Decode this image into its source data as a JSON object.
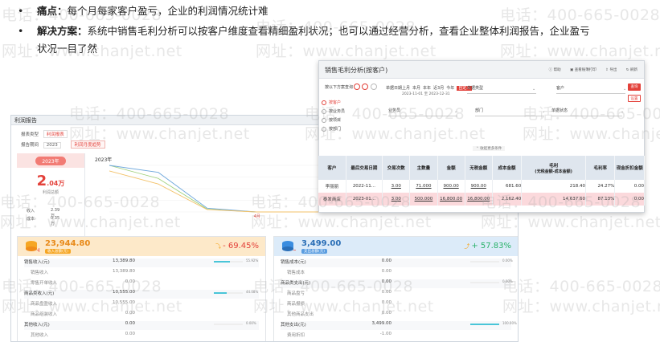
{
  "bullets": [
    {
      "label": "痛点：",
      "text": "每个月每家客户盈亏，企业的利润情况统计难"
    },
    {
      "label": "解决方案：",
      "text": "系统中销售毛利分析可以按客户维度查看精细盈利状况；也可以通过经营分析，查看企业整体利润报告，企业盈亏",
      "text2": "状况一目了然"
    }
  ],
  "watermark": {
    "phone": "电话：400-665-0028",
    "site": "网址：www.chanjet.net"
  },
  "profit_report": {
    "title": "利润报告",
    "filter1_label": "报表类型",
    "filter1_value": "利润报表",
    "filter2_label": "报告期间",
    "filter2_value": "2023",
    "filter2_extra": "利润月度趋势",
    "year_pill": "2023年",
    "profit_value": "2",
    "profit_decimal": ".04",
    "profit_unit": "万",
    "profit_label": "利润总额",
    "income_label": "收入",
    "income_value": "2.39万",
    "cost_label": "成本",
    "cost_value": "0.35万",
    "chart_title": "2023年",
    "chart_month_label": "4月",
    "income_panel": {
      "amount": "23,944.80",
      "tag": "收入总额(元)",
      "change": "- 69.45%",
      "change_sub": "环比",
      "rows": [
        {
          "label": "销售收入(元)",
          "value": "13,389.80",
          "bar": 0.55,
          "pct": "55.92%"
        },
        {
          "label": "销售收入",
          "value": "13,389.80",
          "sub": true
        },
        {
          "label": "零售开单收入",
          "value": "0.00",
          "sub": true
        },
        {
          "label": "商品类收入(元)",
          "value": "10,555.00",
          "bar": 0.44,
          "pct": "44.08%"
        },
        {
          "label": "商品盘盈收入",
          "value": "10,555.00",
          "sub": true
        },
        {
          "label": "商品组装收入",
          "value": "0.00",
          "sub": true
        },
        {
          "label": "其他收入(元)",
          "value": "0.00",
          "bar": 0,
          "pct": "0.00%"
        },
        {
          "label": "其他收入",
          "value": "0.00",
          "sub": true
        }
      ]
    },
    "expense_panel": {
      "amount": "3,499.00",
      "tag": "支出总额(元)",
      "change": "+ 57.83%",
      "change_sub": "环比",
      "rows": [
        {
          "label": "销售成本(元)",
          "value": "0.00",
          "bar": 0,
          "pct": "0.00%"
        },
        {
          "label": "销售成本",
          "value": "0.00",
          "sub": true
        },
        {
          "label": "商品类支出(元)",
          "value": "0.00",
          "bar": 0,
          "pct": "0.00%"
        },
        {
          "label": "商品盘亏",
          "value": "0.00",
          "sub": true
        },
        {
          "label": "商品报损",
          "value": "0.00",
          "sub": true
        },
        {
          "label": "其他商品支出",
          "value": "0.00",
          "sub": true
        },
        {
          "label": "其他支出(元)",
          "value": "3,499.00",
          "bar": 1,
          "pct": "100.00%"
        },
        {
          "label": "费用折扣",
          "value": "-1.00",
          "sub": true
        }
      ]
    }
  },
  "sales_margin": {
    "title": "销售毛利分析(按客户)",
    "tools": [
      "帮助",
      "查看账簿打印",
      "导出",
      "刷新"
    ],
    "query_label": "按以下方案查询",
    "date_label": "单据日期",
    "date_options": [
      "上月",
      "本月",
      "本年",
      "近3月",
      "今年",
      "自定义"
    ],
    "date_selected": "自定义",
    "date_range": "2023-11-01 至 2023-12-31",
    "doc_type_label": "单据类型",
    "customer_label": "客户",
    "salesperson_label": "业务员",
    "dept_label": "部门",
    "status_label": "单据状态",
    "query_btn": "查询",
    "settings_btn": "设置",
    "more_label": "收起更多条件",
    "scheme_items": [
      "按客户",
      "按业务员",
      "按项目",
      "按部门"
    ],
    "columns": [
      "客户",
      "最后交易日期",
      "交易次数",
      "主数量",
      "金额",
      "无税金额",
      "成本金额",
      "毛利\n(无税金额-成本金额)",
      "毛利率",
      "现金折扣金额"
    ],
    "rows": [
      [
        "李丽丽",
        "2022-11...",
        "3.00",
        "71.000",
        "900.00",
        "900.00",
        "681.60",
        "218.40",
        "24.27%",
        "0.00"
      ],
      [
        "泰发商店",
        "2023-01...",
        "3.00",
        "500.000",
        "16,800.00",
        "16,800.00",
        "2,162.40",
        "14,637.60",
        "87.13%",
        "0.00"
      ]
    ]
  },
  "chart_data": {
    "type": "line",
    "title": "2023年",
    "categories": [
      "1",
      "2",
      "3",
      "4"
    ],
    "series": [
      {
        "values": [
          100,
          72,
          6,
          0
        ],
        "color": "#9fd07a"
      },
      {
        "values": [
          100,
          85,
          8,
          0
        ],
        "color": "#6fa8dc"
      },
      {
        "values": [
          88,
          60,
          5,
          0
        ],
        "color": "#f3c26a"
      }
    ],
    "ylim": [
      0,
      100
    ]
  }
}
